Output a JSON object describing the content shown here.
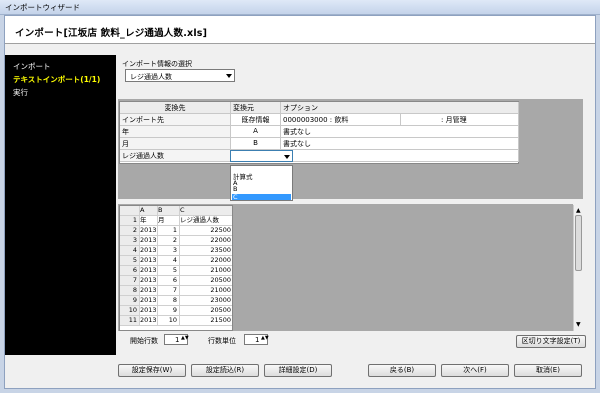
{
  "window": {
    "title": "インポートウィザード"
  },
  "header": {
    "title": "インポート[江坂店 飲料_レジ通過人数.xls]"
  },
  "sidebar": {
    "items": [
      {
        "label": "インポート"
      },
      {
        "label": "テキストインポート(1/1)"
      },
      {
        "label": "実行"
      }
    ]
  },
  "import_info": {
    "label": "インポート情報の選択",
    "selected": "レジ通過人数"
  },
  "mapping": {
    "headers": [
      "変換先",
      "変換元",
      "オプション"
    ],
    "rows": [
      {
        "target": "インポート先",
        "source": "既存情報",
        "option": "0000003000 : 飲料",
        "option2": ": 月管理"
      },
      {
        "target": "年",
        "source": "A",
        "option": "書式なし",
        "option2": ""
      },
      {
        "target": "月",
        "source": "B",
        "option": "書式なし",
        "option2": ""
      },
      {
        "target": "レジ通過人数",
        "source": "",
        "option": "",
        "option2": ""
      }
    ]
  },
  "dropdown_options": [
    "計算式",
    "A",
    "B",
    "C"
  ],
  "preview": {
    "columns": [
      "A",
      "B",
      "C"
    ],
    "field_names": [
      "年",
      "月",
      "レジ通過人数"
    ],
    "rows": [
      [
        "2",
        "2013",
        "1",
        "22500"
      ],
      [
        "3",
        "2013",
        "2",
        "22000"
      ],
      [
        "4",
        "2013",
        "3",
        "23500"
      ],
      [
        "5",
        "2013",
        "4",
        "22000"
      ],
      [
        "6",
        "2013",
        "5",
        "21000"
      ],
      [
        "7",
        "2013",
        "6",
        "20500"
      ],
      [
        "8",
        "2013",
        "7",
        "21000"
      ],
      [
        "9",
        "2013",
        "8",
        "23000"
      ],
      [
        "10",
        "2013",
        "9",
        "20500"
      ],
      [
        "11",
        "2013",
        "10",
        "21500"
      ]
    ],
    "first_row_number": "1"
  },
  "controls": {
    "start_row_label": "開始行数",
    "start_row_value": "1",
    "row_unit_label": "行数単位",
    "row_unit_value": "1",
    "delimiter_button": "区切り文字設定(T)"
  },
  "footer": {
    "save": "設定保存(W)",
    "load": "設定読込(R)",
    "detail": "詳細設定(D)",
    "back": "戻る(B)",
    "next": "次へ(F)",
    "cancel": "取消(E)"
  }
}
